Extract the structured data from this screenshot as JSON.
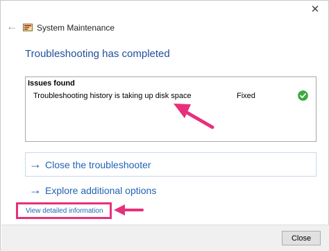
{
  "window": {
    "title": "System Maintenance",
    "close_glyph": "✕",
    "back_glyph": "←",
    "icons": [
      "close-icon",
      "back-arrow-icon",
      "system-maintenance-icon"
    ]
  },
  "heading": "Troubleshooting has completed",
  "issues": {
    "header": "Issues found",
    "rows": [
      {
        "description": "Troubleshooting history is taking up disk space",
        "status": "Fixed",
        "status_icon": "green-check-icon"
      }
    ]
  },
  "options": [
    {
      "arrow": "→",
      "label": "Close the troubleshooter"
    },
    {
      "arrow": "→",
      "label": "Explore additional options"
    }
  ],
  "detail_link": "View detailed information",
  "footer": {
    "close_label": "Close"
  },
  "colors": {
    "accent": "#1f63b5",
    "heading": "#1f4e99",
    "annotation": "#e8307a",
    "check": "#3cae3c"
  }
}
